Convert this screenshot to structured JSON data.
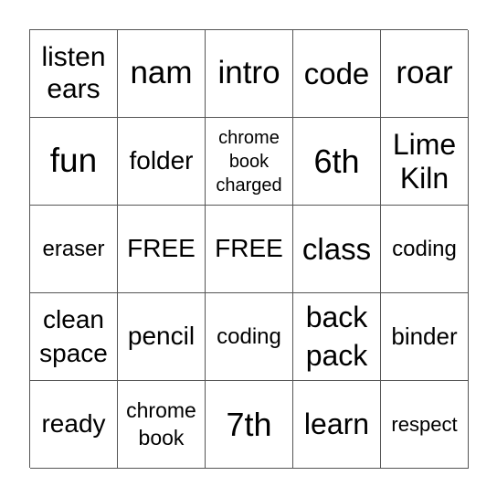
{
  "cells": [
    "listen\nears",
    "nam",
    "intro",
    "code",
    "roar",
    "fun",
    "folder",
    "chrome\nbook\ncharged",
    "6th",
    "Lime\nKiln",
    "eraser",
    "FREE",
    "FREE",
    "class",
    "coding",
    "clean\nspace",
    "pencil",
    "coding",
    "back\npack",
    "binder",
    "ready",
    "chrome\nbook",
    "7th",
    "learn",
    "respect"
  ]
}
